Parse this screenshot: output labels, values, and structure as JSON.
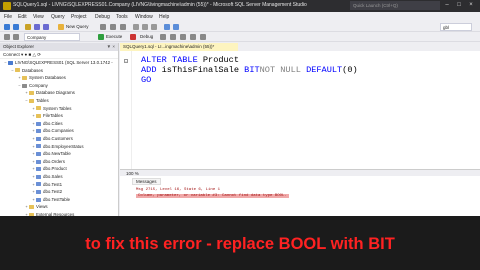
{
  "window": {
    "title": "SQLQuery1.sql - LIVNG\\SQLEXPRESS01.Company (LIVNG\\livingmachine\\admin (55))* - Microsoft SQL Server Management Studio",
    "quick_launch": "Quick Launch (Ctrl+Q)"
  },
  "menu": [
    "File",
    "Edit",
    "View",
    "Query",
    "Project",
    "Debug",
    "Tools",
    "Window",
    "Help"
  ],
  "toolbar1": {
    "new_query": "New Query"
  },
  "toolbar2": {
    "database": "Company",
    "execute": "Execute",
    "debug": "Debug"
  },
  "object_explorer": {
    "title": "Object Explorer",
    "connect": "Connect",
    "tree": [
      {
        "label": "LIVNG\\SQLEXPRESS01 (SQL Server 13.0.1742 -",
        "level": 0,
        "expander": "−",
        "icon": "server"
      },
      {
        "label": "Databases",
        "level": 1,
        "expander": "−",
        "icon": "folder"
      },
      {
        "label": "System Databases",
        "level": 2,
        "expander": "+",
        "icon": "folder"
      },
      {
        "label": "Company",
        "level": 2,
        "expander": "−",
        "icon": "database"
      },
      {
        "label": "Database Diagrams",
        "level": 3,
        "expander": "+",
        "icon": "folder"
      },
      {
        "label": "Tables",
        "level": 3,
        "expander": "−",
        "icon": "folder"
      },
      {
        "label": "System Tables",
        "level": 4,
        "expander": "+",
        "icon": "folder"
      },
      {
        "label": "FileTables",
        "level": 4,
        "expander": "+",
        "icon": "folder"
      },
      {
        "label": "dbo.Cities",
        "level": 4,
        "expander": "+",
        "icon": "table"
      },
      {
        "label": "dbo.Companies",
        "level": 4,
        "expander": "+",
        "icon": "table"
      },
      {
        "label": "dbo.Customers",
        "level": 4,
        "expander": "+",
        "icon": "table"
      },
      {
        "label": "dbo.EmployeeStatus",
        "level": 4,
        "expander": "+",
        "icon": "table"
      },
      {
        "label": "dbo.NewTable",
        "level": 4,
        "expander": "+",
        "icon": "table"
      },
      {
        "label": "dbo.Orders",
        "level": 4,
        "expander": "+",
        "icon": "table"
      },
      {
        "label": "dbo.Product",
        "level": 4,
        "expander": "+",
        "icon": "table"
      },
      {
        "label": "dbo.Sales",
        "level": 4,
        "expander": "+",
        "icon": "table"
      },
      {
        "label": "dbo.Test1",
        "level": 4,
        "expander": "+",
        "icon": "table"
      },
      {
        "label": "dbo.Test2",
        "level": 4,
        "expander": "+",
        "icon": "table"
      },
      {
        "label": "dbo.TestTable",
        "level": 4,
        "expander": "+",
        "icon": "table"
      },
      {
        "label": "Views",
        "level": 3,
        "expander": "+",
        "icon": "folder"
      },
      {
        "label": "External Resources",
        "level": 3,
        "expander": "+",
        "icon": "folder"
      }
    ]
  },
  "editor": {
    "tab_label": "SQLQuery1.sql - LI...ingmachine\\admin (55))*",
    "lines": [
      {
        "kw1": "ALTER TABLE",
        "id1": " Product",
        "gr": "",
        "rest": ""
      },
      {
        "kw1": "ADD",
        "id1": " isThisFinalSale ",
        "kw2": "BIT",
        "gr": "NOT NULL",
        "kw3": " DEFAULT",
        "rest": "(0)"
      },
      {
        "kw1": "GO",
        "id1": "",
        "gr": "",
        "rest": ""
      }
    ],
    "zoom": "100 %"
  },
  "results": {
    "tab": "Messages",
    "line1": "Msg 2715, Level 16, State 6, Line 1",
    "line2": "Column, parameter, or variable #3: Cannot find data type BOOL."
  },
  "caption": "to fix this error - replace BOOL with BIT",
  "colors": {
    "keyword": "#0000ff",
    "greyed": "#808080",
    "error_text": "#a31515",
    "error_highlight": "#f0a9a9",
    "caption": "#ff2222"
  }
}
